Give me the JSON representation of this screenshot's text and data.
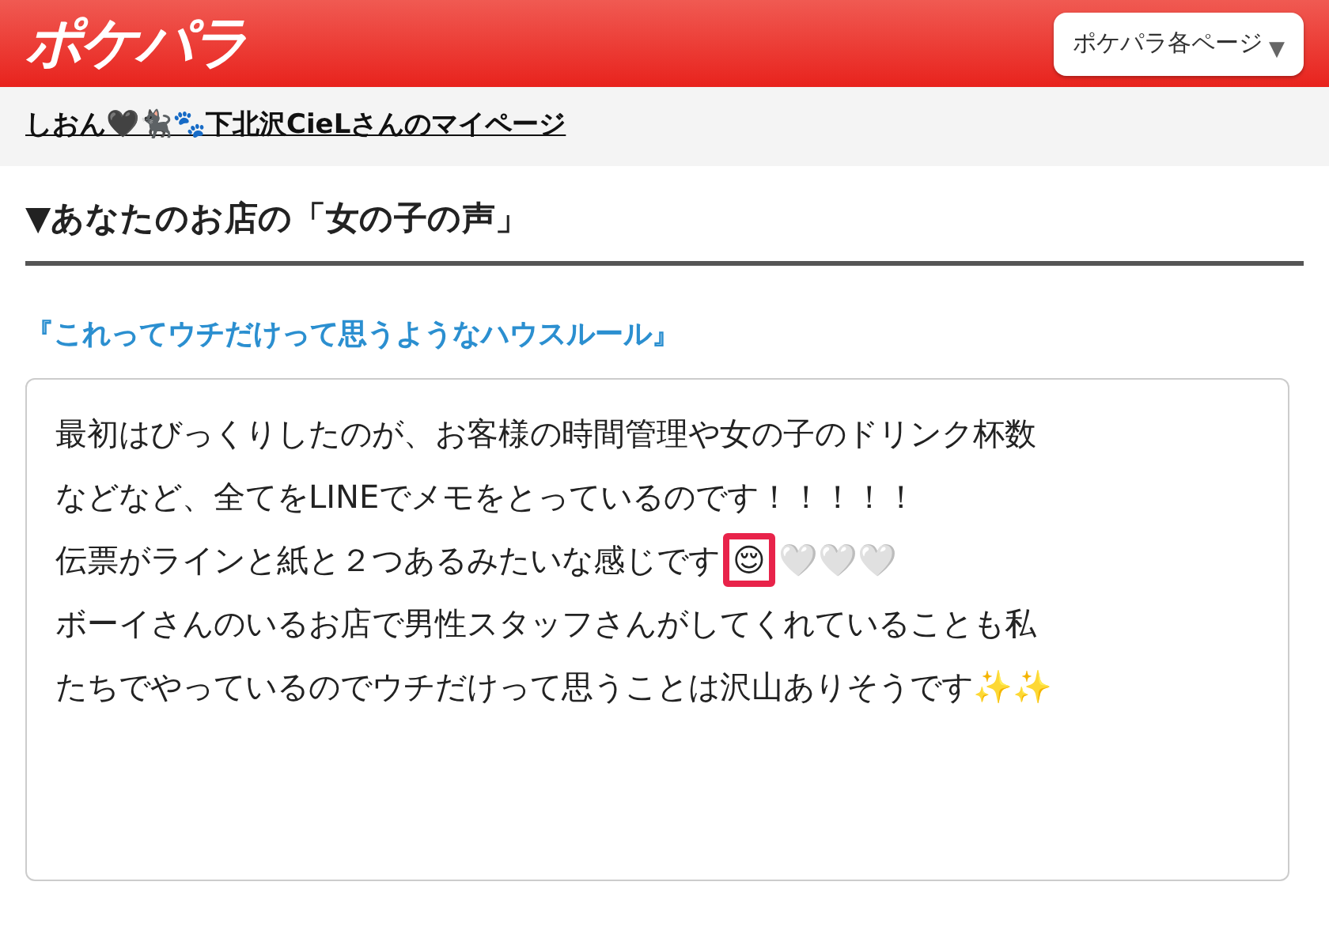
{
  "header": {
    "logo": "ポケパラ",
    "menu_button": {
      "label": "ポケパラ各ページ",
      "caret": "▼"
    }
  },
  "mypage_link": "しおん🖤🐈‍⬛🐾下北沢CieLさんのマイページ",
  "section": {
    "marker": "▼",
    "title": "あなたのお店の「女の子の声」"
  },
  "question": "『これってウチだけって思うようなハウスルール』",
  "answer_lines": [
    {
      "text": "最初はびっくりしたのが、お客様の時間管理や女の子のドリンク杯数"
    },
    {
      "text": "などなど、全てをLINEでメモをとっているのです！！！！！"
    },
    {
      "text": "伝票がラインと紙と２つあるみたいな感じです",
      "highlighted": "😌",
      "after": "🤍🤍🤍"
    },
    {
      "text": "ボーイさんのいるお店で男性スタッフさんがしてくれていることも私"
    },
    {
      "text": "たちでやっているのでウチだけって思うことは沢山ありそうです✨✨"
    }
  ]
}
